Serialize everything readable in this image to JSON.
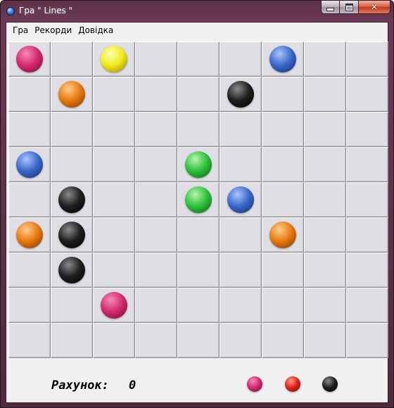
{
  "window": {
    "title": "Гра \" Lines \""
  },
  "menu": [
    {
      "label": "Гра"
    },
    {
      "label": "Рекорди"
    },
    {
      "label": "Довідка"
    }
  ],
  "board": {
    "rows": 9,
    "cols": 9,
    "balls": [
      {
        "row": 1,
        "col": 1,
        "color": "pink"
      },
      {
        "row": 1,
        "col": 3,
        "color": "yellow"
      },
      {
        "row": 1,
        "col": 7,
        "color": "blue"
      },
      {
        "row": 2,
        "col": 2,
        "color": "orange"
      },
      {
        "row": 2,
        "col": 6,
        "color": "black"
      },
      {
        "row": 4,
        "col": 1,
        "color": "blue"
      },
      {
        "row": 4,
        "col": 5,
        "color": "green"
      },
      {
        "row": 5,
        "col": 2,
        "color": "black"
      },
      {
        "row": 5,
        "col": 5,
        "color": "green"
      },
      {
        "row": 5,
        "col": 6,
        "color": "blue"
      },
      {
        "row": 6,
        "col": 1,
        "color": "orange"
      },
      {
        "row": 6,
        "col": 2,
        "color": "black"
      },
      {
        "row": 6,
        "col": 7,
        "color": "orange"
      },
      {
        "row": 7,
        "col": 2,
        "color": "black"
      },
      {
        "row": 8,
        "col": 3,
        "color": "pink"
      }
    ]
  },
  "footer": {
    "score_label": "Рахунок:",
    "score_value": "0",
    "next_balls": [
      "pink",
      "red",
      "black"
    ]
  },
  "colors": {
    "pink": {
      "light": "#f58ab8",
      "mid": "#d4286f",
      "dark": "#6e0a32"
    },
    "yellow": {
      "light": "#ffffb0",
      "mid": "#f0ea1a",
      "dark": "#8a7d00"
    },
    "blue": {
      "light": "#a9c4ff",
      "mid": "#3a68c8",
      "dark": "#102a6a"
    },
    "orange": {
      "light": "#ffce8a",
      "mid": "#e7780f",
      "dark": "#7a3500"
    },
    "black": {
      "light": "#8a8a8a",
      "mid": "#1e1e1e",
      "dark": "#000000"
    },
    "green": {
      "light": "#b6f5b0",
      "mid": "#2ec13a",
      "dark": "#0a5a12"
    },
    "red": {
      "light": "#ff9a8a",
      "mid": "#e0201a",
      "dark": "#6a0400"
    }
  }
}
